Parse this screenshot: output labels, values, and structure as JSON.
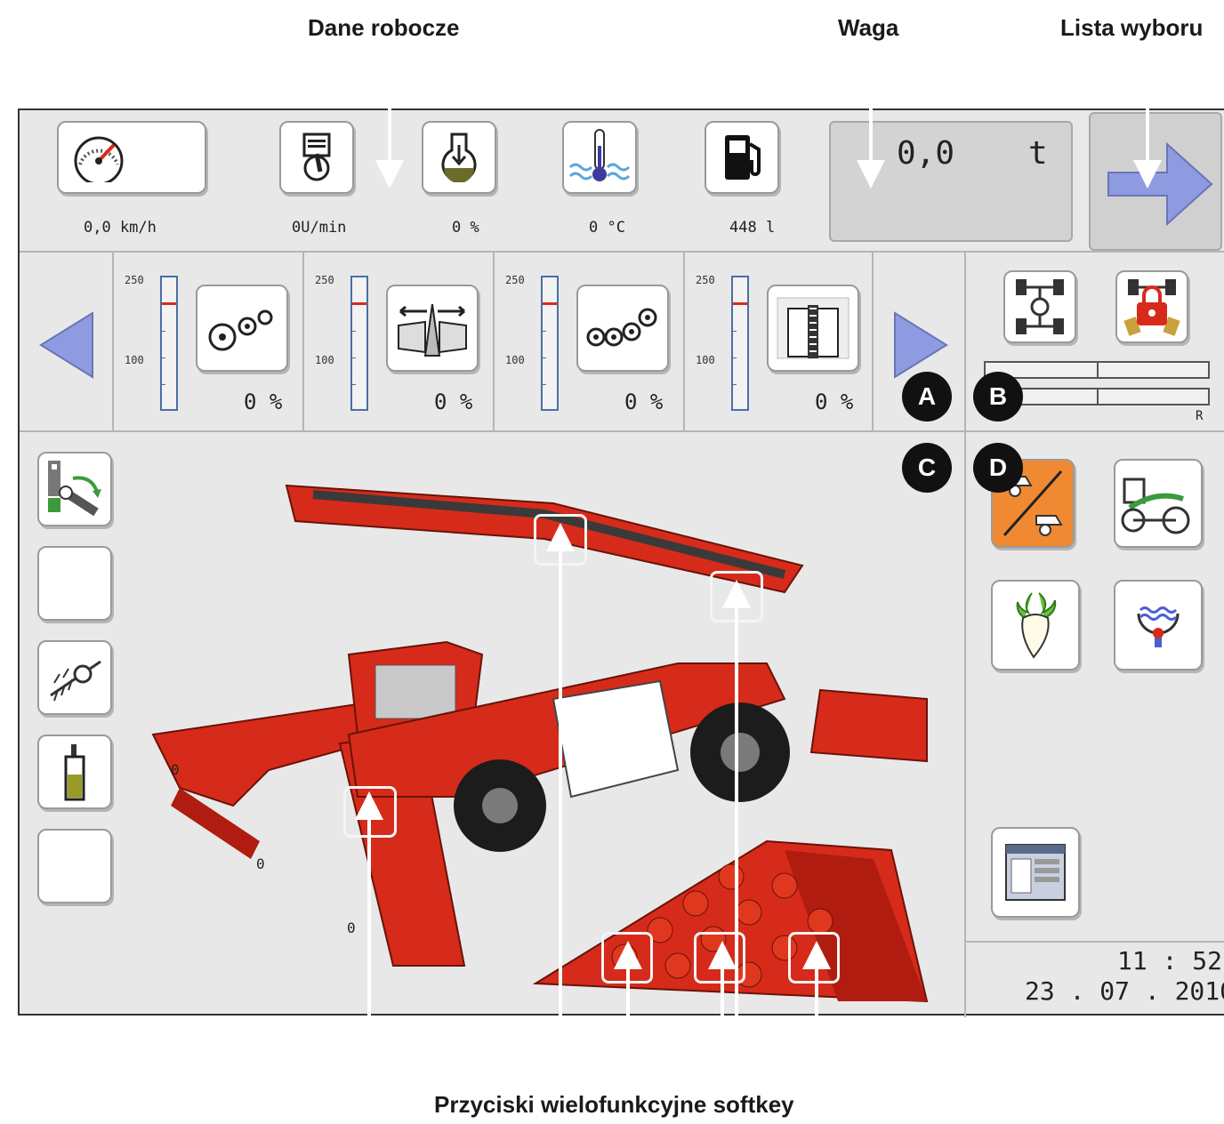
{
  "callouts": {
    "work_data": "Dane robocze",
    "weight": "Waga",
    "selection_list": "Lista wyboru",
    "softkeys": "Przyciski wielofunkcyjne softkey"
  },
  "status_bar": {
    "speed": "0,0 km/h",
    "engine_rpm": "0U/min",
    "load": "0 %",
    "temperature": "0 °C",
    "fuel": "448 l"
  },
  "weight": {
    "value": "0,0",
    "unit": "t"
  },
  "gauges": [
    {
      "scale_top": "250",
      "scale_mid": "100",
      "percent": "0 %",
      "icon": "rotor-icon"
    },
    {
      "scale_top": "250",
      "scale_mid": "100",
      "percent": "0 %",
      "icon": "spreader-icon"
    },
    {
      "scale_top": "250",
      "scale_mid": "100",
      "percent": "0 %",
      "icon": "cleaning-rollers-icon"
    },
    {
      "scale_top": "250",
      "scale_mid": "100",
      "percent": "0 %",
      "icon": "conveyor-icon"
    }
  ],
  "steering": {
    "right_label": "R"
  },
  "badges": [
    "A",
    "B",
    "C",
    "D"
  ],
  "machine_values": [
    "0",
    "0",
    "0"
  ],
  "clock": {
    "time": "11 : 52",
    "date": "23 . 07 . 2010"
  },
  "colors": {
    "accent_red": "#d62b1a",
    "arrow_blue": "#8f9be0",
    "orange": "#f08a32"
  }
}
